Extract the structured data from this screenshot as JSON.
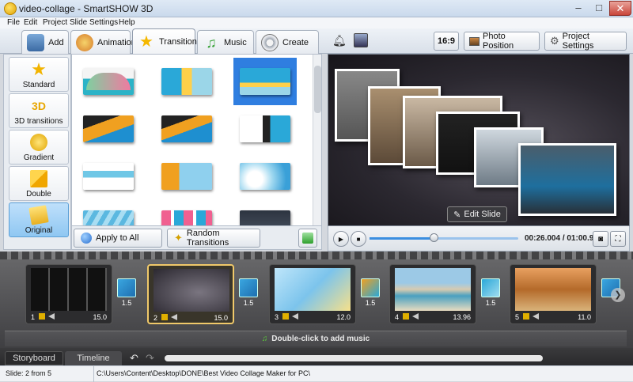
{
  "window": {
    "title": "video-collage - SmartSHOW 3D"
  },
  "menu": [
    "File",
    "Edit",
    "Project",
    "Slide",
    "Settings",
    "Help"
  ],
  "tabs": [
    {
      "label": "Add",
      "icon": "camera-icon"
    },
    {
      "label": "Animation",
      "icon": "palette-icon"
    },
    {
      "label": "Transitions",
      "icon": "star-icon",
      "active": true
    },
    {
      "label": "Music",
      "icon": "music-note-icon"
    },
    {
      "label": "Create",
      "icon": "film-reel-icon"
    }
  ],
  "toolbar_right": {
    "aspect": "16:9",
    "photo_position": "Photo Position",
    "project_settings": "Project Settings"
  },
  "categories": [
    {
      "label": "Standard"
    },
    {
      "label": "3D transitions"
    },
    {
      "label": "Gradient"
    },
    {
      "label": "Double"
    },
    {
      "label": "Original",
      "active": true
    }
  ],
  "left_buttons": {
    "apply_all": "Apply to All",
    "random": "Random Transitions"
  },
  "preview": {
    "edit_slide": "Edit Slide"
  },
  "playback": {
    "timecode": "00:26.004 / 01:00.960",
    "progress": 0.43
  },
  "slides": [
    {
      "num": "1",
      "duration": "15.0",
      "transition": "1.5"
    },
    {
      "num": "2",
      "duration": "15.0",
      "transition": "1.5",
      "active": true
    },
    {
      "num": "3",
      "duration": "12.0",
      "transition": "1.5"
    },
    {
      "num": "4",
      "duration": "13.96",
      "transition": "1.5"
    },
    {
      "num": "5",
      "duration": "11.0",
      "transition": ""
    }
  ],
  "music_hint": "Double-click to add music",
  "view_tabs": {
    "storyboard": "Storyboard",
    "timeline": "Timeline"
  },
  "status": {
    "slide": "Slide: 2 from 5",
    "path": "C:\\Users\\Content\\Desktop\\DONE\\Best Video Collage Maker for PC\\"
  }
}
